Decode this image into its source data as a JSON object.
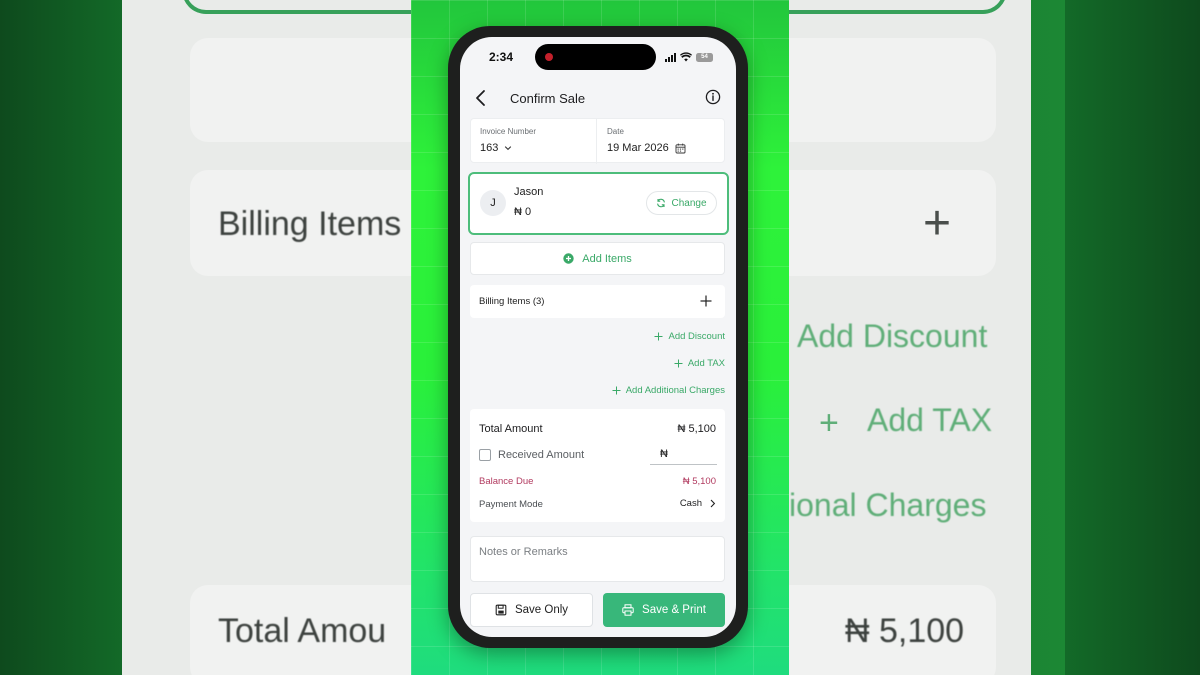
{
  "status_bar": {
    "time": "2:34",
    "battery": "54"
  },
  "header": {
    "title": "Confirm Sale",
    "back_icon": "chevron-left-icon",
    "info_icon": "info-circle-icon"
  },
  "invoice": {
    "number_label": "Invoice Number",
    "number": "163",
    "date_label": "Date",
    "date": "19 Mar 2026"
  },
  "customer": {
    "initial": "J",
    "name": "Jason",
    "balance": "₦ 0",
    "change_label": "Change"
  },
  "add_items_label": "Add Items",
  "billing": {
    "label": "Billing Items (3)"
  },
  "links": {
    "add_discount": "Add Discount",
    "add_tax": "Add TAX",
    "add_charges": "Add Additional Charges"
  },
  "totals": {
    "total_label": "Total Amount",
    "total_value": "₦ 5,100",
    "received_label": "Received Amount",
    "received_currency": "₦",
    "balance_label": "Balance Due",
    "balance_value": "₦ 5,100",
    "payment_label": "Payment Mode",
    "payment_value": "Cash"
  },
  "notes_placeholder": "Notes or Remarks",
  "buttons": {
    "save_only": "Save Only",
    "save_print": "Save & Print"
  },
  "background": {
    "billing_items": "Billing Items (",
    "add_discount": "Add Discount",
    "add_tax": "Add TAX",
    "charges_fragment": "ional Charges",
    "total_fragment": "Total Amou",
    "total_value": "₦ 5,100"
  },
  "colors": {
    "accent": "#38b77a",
    "balance_due": "#b13a5f",
    "green_backdrop": "#2af03a"
  }
}
